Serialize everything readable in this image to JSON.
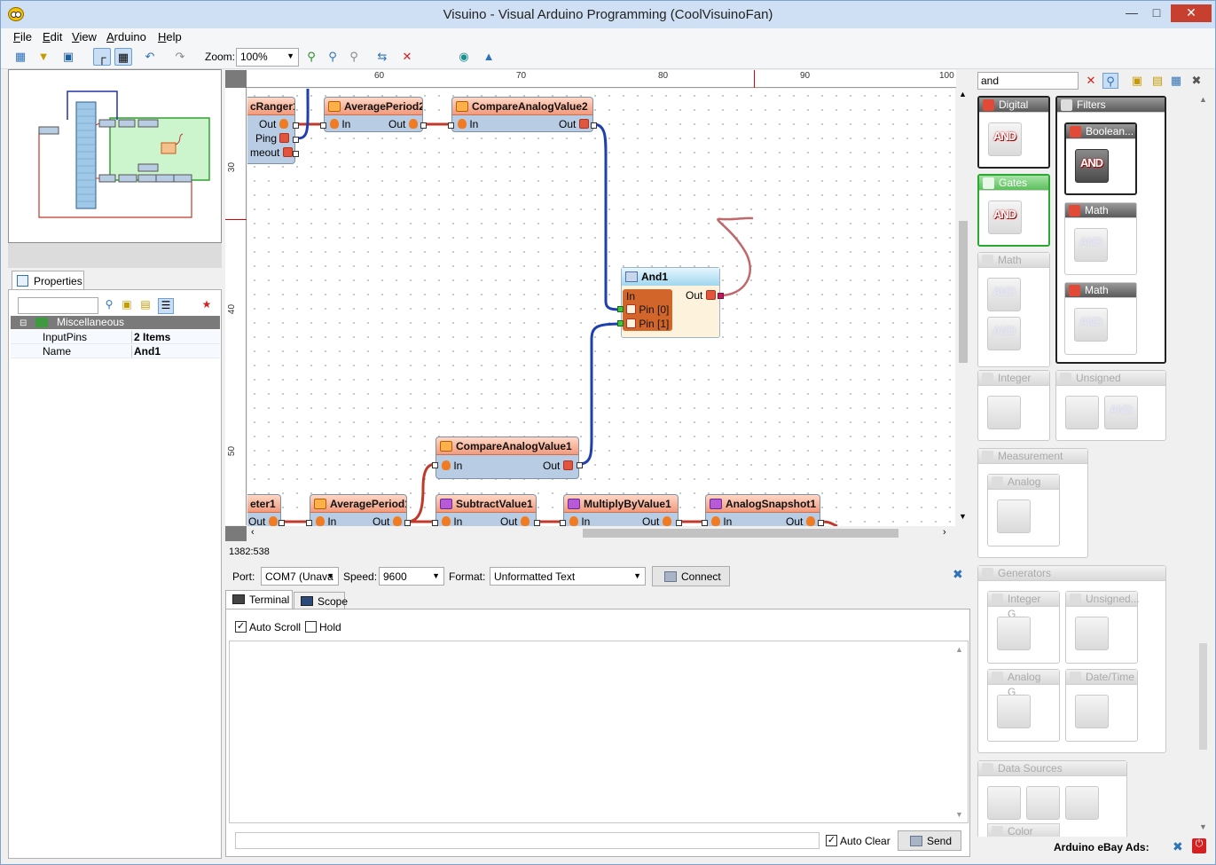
{
  "window": {
    "title": "Visuino - Visual Arduino Programming (CoolVisuinoFan)"
  },
  "menu": {
    "items": [
      "File",
      "Edit",
      "View",
      "Arduino",
      "Help"
    ]
  },
  "toolbar": {
    "zoom_label": "Zoom:",
    "zoom_value": "100%"
  },
  "properties": {
    "tab_label": "Properties",
    "category": "Miscellaneous",
    "rows": [
      {
        "key": "InputPins",
        "value": "2 Items"
      },
      {
        "key": "Name",
        "value": "And1"
      }
    ]
  },
  "ruler": {
    "top": [
      "60",
      "70",
      "80",
      "90",
      "100"
    ],
    "left": [
      "30",
      "40",
      "50"
    ]
  },
  "diagram": {
    "nodes": {
      "ranger": {
        "title": "cRanger1",
        "pins": [
          "Out",
          "Ping",
          "meout"
        ]
      },
      "avg2": {
        "title": "AveragePeriod2",
        "in": "In",
        "out": "Out"
      },
      "cmp2": {
        "title": "CompareAnalogValue2",
        "in": "In",
        "out": "Out"
      },
      "and1": {
        "title": "And1",
        "in": "In",
        "out": "Out",
        "pin0": "Pin [0]",
        "pin1": "Pin [1]"
      },
      "cmp1": {
        "title": "CompareAnalogValue1",
        "in": "In",
        "out": "Out"
      },
      "meter": {
        "title": "eter1",
        "out": "Out"
      },
      "avg1": {
        "title": "AveragePeriod1",
        "in": "In",
        "out": "Out"
      },
      "sub1": {
        "title": "SubtractValue1",
        "in": "In",
        "out": "Out"
      },
      "mul1": {
        "title": "MultiplyByValue1",
        "in": "In",
        "out": "Out"
      },
      "snap1": {
        "title": "AnalogSnapshot1",
        "in": "In",
        "out": "Out"
      }
    }
  },
  "status": {
    "coords": "1382:538"
  },
  "serial": {
    "port_label": "Port:",
    "port_value": "COM7 (Unava",
    "speed_label": "Speed:",
    "speed_value": "9600",
    "format_label": "Format:",
    "format_value": "Unformatted Text",
    "connect_label": "Connect",
    "tabs": [
      "Terminal",
      "Scope"
    ],
    "auto_scroll": "Auto Scroll",
    "hold": "Hold",
    "auto_clear": "Auto Clear",
    "send": "Send"
  },
  "palette": {
    "search_value": "and",
    "groups": {
      "digital": "Digital",
      "filters": "Filters",
      "boolean": "Boolean...",
      "gates": "Gates",
      "math_a": "Math",
      "math_b": "Math",
      "math_c": "Math",
      "integer": "Integer",
      "unsigned": "Unsigned",
      "measurement": "Measurement",
      "analog": "Analog",
      "generators": "Generators",
      "integer_g": "Integer G...",
      "unsigned_g": "Unsigned...",
      "analog_g": "Analog G...",
      "datetime": "Date/Time",
      "data_sources": "Data Sources",
      "color": "Color"
    },
    "and_text": "AND",
    "ads_label": "Arduino eBay Ads:"
  },
  "colors": {
    "accent": "#6f9ed1",
    "wire_red": "#c0392b",
    "wire_blue": "#1f3fb0",
    "selected_green": "#2aa832"
  }
}
